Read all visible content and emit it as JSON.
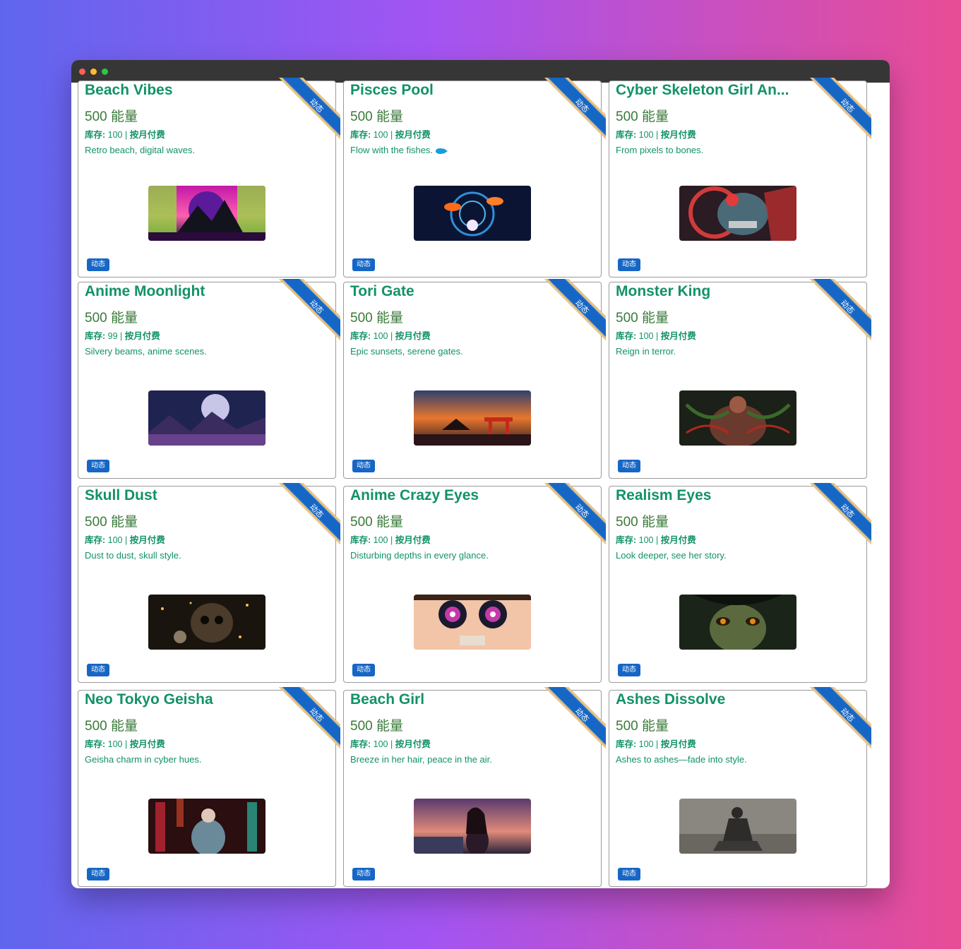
{
  "window": {
    "controls": [
      "close",
      "minimize",
      "maximize"
    ]
  },
  "labels": {
    "stock_label": "库存:",
    "separator": "|",
    "billing": "按月付费",
    "badge": "动态",
    "ribbon": "动态"
  },
  "cards": [
    {
      "title": "Beach Vibes",
      "price": "500 能量",
      "stock": "100",
      "desc": "Retro beach, digital waves."
    },
    {
      "title": "Pisces Pool",
      "price": "500 能量",
      "stock": "100",
      "desc": "Flow with the fishes."
    },
    {
      "title": "Cyber Skeleton Girl An...",
      "price": "500 能量",
      "stock": "100",
      "desc": "From pixels to bones."
    },
    {
      "title": "Anime Moonlight",
      "price": "500 能量",
      "stock": "99",
      "desc": "Silvery beams, anime scenes."
    },
    {
      "title": "Tori Gate",
      "price": "500 能量",
      "stock": "100",
      "desc": "Epic sunsets, serene gates."
    },
    {
      "title": "Monster King",
      "price": "500 能量",
      "stock": "100",
      "desc": "Reign in terror."
    },
    {
      "title": "Skull Dust",
      "price": "500 能量",
      "stock": "100",
      "desc": "Dust to dust, skull style."
    },
    {
      "title": "Anime Crazy Eyes",
      "price": "500 能量",
      "stock": "100",
      "desc": "Disturbing depths in every glance."
    },
    {
      "title": "Realism Eyes",
      "price": "500 能量",
      "stock": "100",
      "desc": "Look deeper, see her story."
    },
    {
      "title": "Neo Tokyo Geisha",
      "price": "500 能量",
      "stock": "100",
      "desc": "Geisha charm in cyber hues."
    },
    {
      "title": "Beach Girl",
      "price": "500 能量",
      "stock": "100",
      "desc": "Breeze in her hair, peace in the air."
    },
    {
      "title": "Ashes Dissolve",
      "price": "500 能量",
      "stock": "100",
      "desc": "Ashes to ashes—fade into style."
    }
  ]
}
